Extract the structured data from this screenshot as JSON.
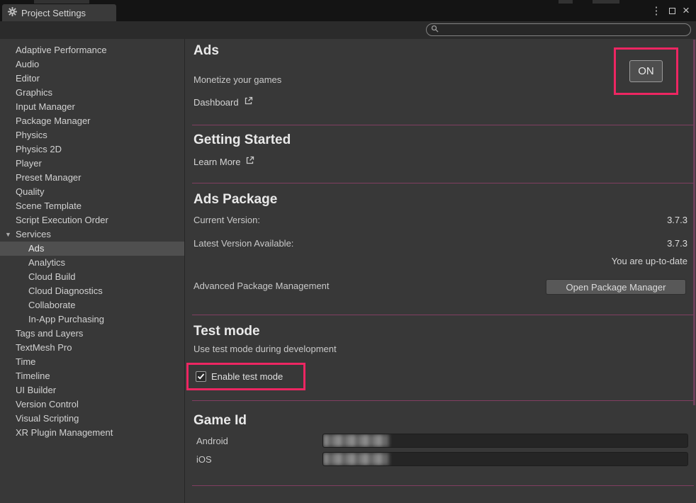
{
  "colors": {
    "annotation": "#ed2662",
    "background": "#383838",
    "titlebar": "#141414",
    "selection": "#4f4f4f",
    "divider": "#8e4068",
    "button": "#585858"
  },
  "window": {
    "tab_title": "Project Settings",
    "menu_glyph": "⋮",
    "close_glyph": "×"
  },
  "search": {
    "value": "",
    "placeholder": ""
  },
  "sidebar": {
    "foldout_glyph": "▼",
    "items": [
      {
        "label": "Adaptive Performance",
        "level": 0
      },
      {
        "label": "Audio",
        "level": 0
      },
      {
        "label": "Editor",
        "level": 0
      },
      {
        "label": "Graphics",
        "level": 0
      },
      {
        "label": "Input Manager",
        "level": 0
      },
      {
        "label": "Package Manager",
        "level": 0
      },
      {
        "label": "Physics",
        "level": 0
      },
      {
        "label": "Physics 2D",
        "level": 0
      },
      {
        "label": "Player",
        "level": 0
      },
      {
        "label": "Preset Manager",
        "level": 0
      },
      {
        "label": "Quality",
        "level": 0
      },
      {
        "label": "Scene Template",
        "level": 0
      },
      {
        "label": "Script Execution Order",
        "level": 0
      },
      {
        "label": "Services",
        "level": 0,
        "expanded": true
      },
      {
        "label": "Ads",
        "level": 1,
        "selected": true
      },
      {
        "label": "Analytics",
        "level": 1
      },
      {
        "label": "Cloud Build",
        "level": 1
      },
      {
        "label": "Cloud Diagnostics",
        "level": 1
      },
      {
        "label": "Collaborate",
        "level": 1
      },
      {
        "label": "In-App Purchasing",
        "level": 1
      },
      {
        "label": "Tags and Layers",
        "level": 0
      },
      {
        "label": "TextMesh Pro",
        "level": 0
      },
      {
        "label": "Time",
        "level": 0
      },
      {
        "label": "Timeline",
        "level": 0
      },
      {
        "label": "UI Builder",
        "level": 0
      },
      {
        "label": "Version Control",
        "level": 0
      },
      {
        "label": "Visual Scripting",
        "level": 0
      },
      {
        "label": "XR Plugin Management",
        "level": 0
      }
    ]
  },
  "main": {
    "ads": {
      "title": "Ads",
      "subtitle": "Monetize your games",
      "dashboard_link": "Dashboard",
      "on_button": "ON"
    },
    "getting_started": {
      "title": "Getting Started",
      "learn_more_link": "Learn More"
    },
    "ads_package": {
      "title": "Ads Package",
      "current_version_label": "Current Version:",
      "current_version": "3.7.3",
      "latest_version_label": "Latest Version Available:",
      "latest_version": "3.7.3",
      "up_to_date": "You are up-to-date",
      "advanced_label": "Advanced Package Management",
      "open_package_manager_button": "Open Package Manager"
    },
    "test_mode": {
      "title": "Test mode",
      "subtitle": "Use test mode during development",
      "enable_label": "Enable test mode",
      "enabled": true
    },
    "game_id": {
      "title": "Game Id",
      "android_label": "Android",
      "ios_label": "iOS",
      "android_redacted": true,
      "ios_redacted": true
    }
  }
}
